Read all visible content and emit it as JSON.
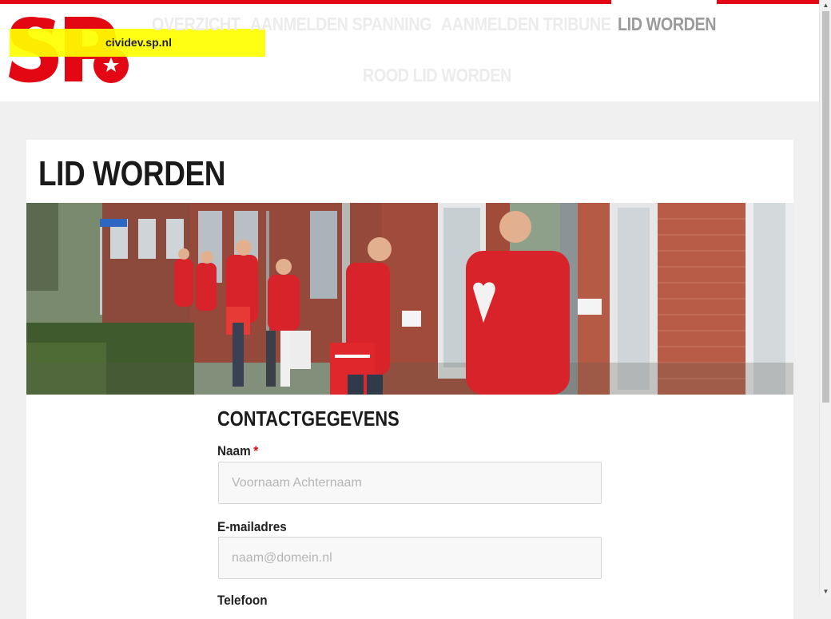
{
  "banner": {
    "host": "cividev.sp.nl"
  },
  "brand": {
    "logo_text": "SP",
    "red": "#e30613"
  },
  "nav": {
    "items": [
      {
        "label": "OVERZICHT",
        "active": false
      },
      {
        "label": "AANMELDEN SPANNING",
        "active": false
      },
      {
        "label": "AANMELDEN TRIBUNE",
        "active": false
      },
      {
        "label": "LID WORDEN",
        "active": true
      },
      {
        "label": "ROOD LID WORDEN",
        "active": false
      }
    ]
  },
  "page": {
    "title": "LID WORDEN",
    "hero_description": "SP-leden in rode jassen voeren huis-aan-huis actie in een straat met rode bakstenen huizen"
  },
  "form": {
    "section_title": "CONTACTGEGEVENS",
    "fields": {
      "name": {
        "label": "Naam",
        "required_mark": "*",
        "placeholder": "Voornaam Achternaam",
        "value": ""
      },
      "email": {
        "label": "E-mailadres",
        "placeholder": "naam@domein.nl",
        "value": ""
      },
      "phone": {
        "label": "Telefoon"
      }
    }
  },
  "scrollbar": {
    "up_icon": "▲",
    "down_icon": "▼"
  }
}
